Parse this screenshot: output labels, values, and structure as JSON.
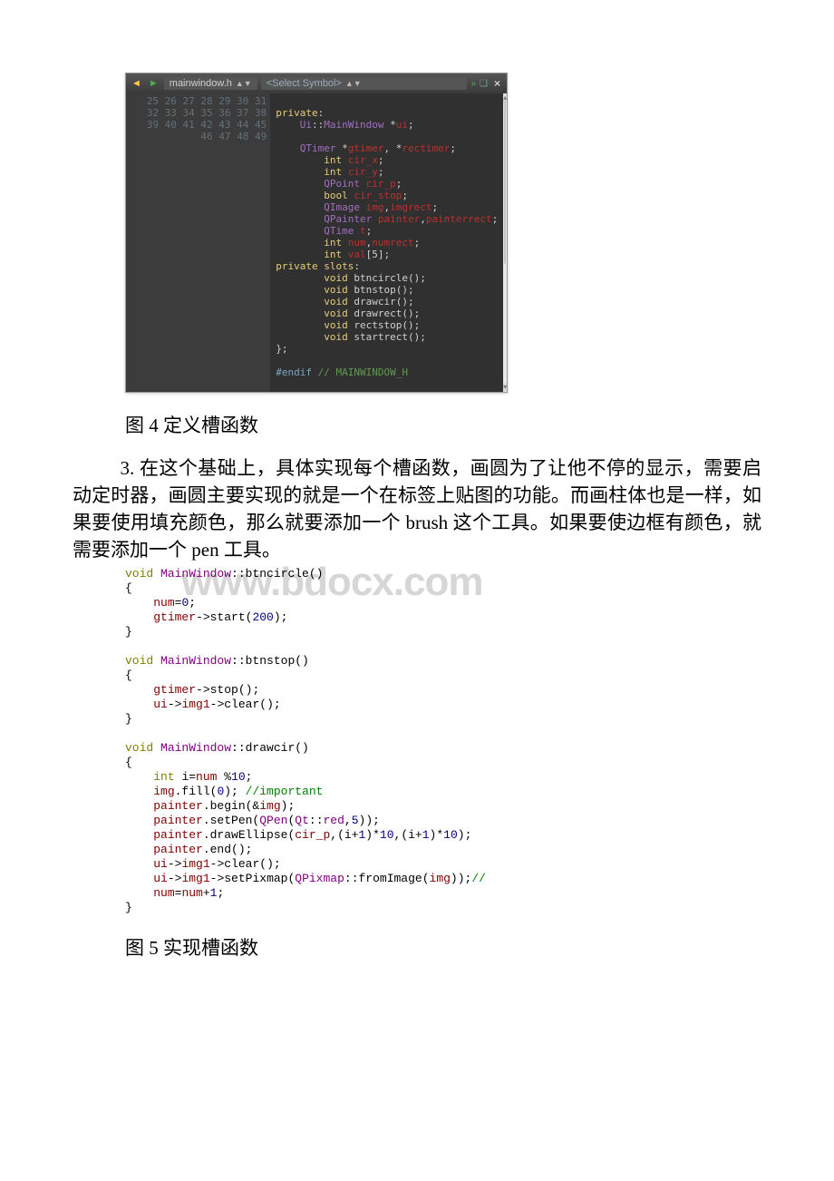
{
  "toolbar": {
    "file_name": "mainwindow.h",
    "symbol_placeholder": "<Select Symbol>"
  },
  "gutter": {
    "start": 25,
    "end": 49
  },
  "header_code": {
    "lines": [
      {
        "n": 25,
        "seg": [
          {
            "t": "",
            "c": ""
          }
        ]
      },
      {
        "n": 26,
        "seg": [
          {
            "t": "private",
            "c": "kw"
          },
          {
            "t": ":",
            "c": "white"
          }
        ]
      },
      {
        "n": 27,
        "seg": [
          {
            "t": "    ",
            "c": ""
          },
          {
            "t": "Ui",
            "c": "type"
          },
          {
            "t": "::",
            "c": "white"
          },
          {
            "t": "MainWindow",
            "c": "type"
          },
          {
            "t": " *",
            "c": "white"
          },
          {
            "t": "ui",
            "c": "ident"
          },
          {
            "t": ";",
            "c": "white"
          }
        ]
      },
      {
        "n": 28,
        "seg": [
          {
            "t": "",
            "c": ""
          }
        ]
      },
      {
        "n": 29,
        "seg": [
          {
            "t": "    ",
            "c": ""
          },
          {
            "t": "QTimer",
            "c": "type"
          },
          {
            "t": " *",
            "c": "white"
          },
          {
            "t": "gtimer",
            "c": "ident"
          },
          {
            "t": ", *",
            "c": "white"
          },
          {
            "t": "rectimer",
            "c": "ident"
          },
          {
            "t": ";",
            "c": "white"
          }
        ]
      },
      {
        "n": 30,
        "seg": [
          {
            "t": "        ",
            "c": ""
          },
          {
            "t": "int",
            "c": "kw2"
          },
          {
            "t": " ",
            "c": ""
          },
          {
            "t": "cir_x",
            "c": "ident"
          },
          {
            "t": ";",
            "c": "white"
          }
        ]
      },
      {
        "n": 31,
        "seg": [
          {
            "t": "        ",
            "c": ""
          },
          {
            "t": "int",
            "c": "kw2"
          },
          {
            "t": " ",
            "c": ""
          },
          {
            "t": "cir_y",
            "c": "ident"
          },
          {
            "t": ";",
            "c": "white"
          }
        ]
      },
      {
        "n": 32,
        "seg": [
          {
            "t": "        ",
            "c": ""
          },
          {
            "t": "QPoint",
            "c": "type"
          },
          {
            "t": " ",
            "c": ""
          },
          {
            "t": "cir_p",
            "c": "ident"
          },
          {
            "t": ";",
            "c": "white"
          }
        ]
      },
      {
        "n": 33,
        "seg": [
          {
            "t": "        ",
            "c": ""
          },
          {
            "t": "bool",
            "c": "kw2"
          },
          {
            "t": " ",
            "c": ""
          },
          {
            "t": "cir_stop",
            "c": "ident"
          },
          {
            "t": ";",
            "c": "white"
          }
        ]
      },
      {
        "n": 34,
        "seg": [
          {
            "t": "        ",
            "c": ""
          },
          {
            "t": "QImage",
            "c": "type"
          },
          {
            "t": " ",
            "c": ""
          },
          {
            "t": "img",
            "c": "ident"
          },
          {
            "t": ",",
            "c": "white"
          },
          {
            "t": "imgrect",
            "c": "ident"
          },
          {
            "t": ";",
            "c": "white"
          }
        ]
      },
      {
        "n": 35,
        "seg": [
          {
            "t": "        ",
            "c": ""
          },
          {
            "t": "QPainter",
            "c": "type"
          },
          {
            "t": " ",
            "c": ""
          },
          {
            "t": "painter",
            "c": "ident"
          },
          {
            "t": ",",
            "c": "white"
          },
          {
            "t": "painterrect",
            "c": "ident"
          },
          {
            "t": ";",
            "c": "white"
          }
        ]
      },
      {
        "n": 36,
        "seg": [
          {
            "t": "        ",
            "c": ""
          },
          {
            "t": "QTime",
            "c": "type"
          },
          {
            "t": " ",
            "c": ""
          },
          {
            "t": "t",
            "c": "ident"
          },
          {
            "t": ";",
            "c": "white"
          }
        ]
      },
      {
        "n": 37,
        "seg": [
          {
            "t": "        ",
            "c": ""
          },
          {
            "t": "int",
            "c": "kw2"
          },
          {
            "t": " ",
            "c": ""
          },
          {
            "t": "num",
            "c": "ident"
          },
          {
            "t": ",",
            "c": "white"
          },
          {
            "t": "numrect",
            "c": "ident"
          },
          {
            "t": ";",
            "c": "white"
          }
        ]
      },
      {
        "n": 38,
        "seg": [
          {
            "t": "        ",
            "c": ""
          },
          {
            "t": "int",
            "c": "kw2"
          },
          {
            "t": " ",
            "c": ""
          },
          {
            "t": "val",
            "c": "ident"
          },
          {
            "t": "[",
            "c": "white"
          },
          {
            "t": "5",
            "c": "white"
          },
          {
            "t": "];",
            "c": "white"
          }
        ]
      },
      {
        "n": 39,
        "seg": [
          {
            "t": "private",
            "c": "kw"
          },
          {
            "t": " ",
            "c": ""
          },
          {
            "t": "slots",
            "c": "kw"
          },
          {
            "t": ":",
            "c": "white"
          }
        ]
      },
      {
        "n": 40,
        "seg": [
          {
            "t": "        ",
            "c": ""
          },
          {
            "t": "void",
            "c": "kw2"
          },
          {
            "t": " ",
            "c": ""
          },
          {
            "t": "btncircle",
            "c": "white"
          },
          {
            "t": "();",
            "c": "white"
          }
        ]
      },
      {
        "n": 41,
        "seg": [
          {
            "t": "        ",
            "c": ""
          },
          {
            "t": "void",
            "c": "kw2"
          },
          {
            "t": " ",
            "c": ""
          },
          {
            "t": "btnstop",
            "c": "white"
          },
          {
            "t": "();",
            "c": "white"
          }
        ]
      },
      {
        "n": 42,
        "seg": [
          {
            "t": "        ",
            "c": ""
          },
          {
            "t": "void",
            "c": "kw2"
          },
          {
            "t": " ",
            "c": ""
          },
          {
            "t": "drawcir",
            "c": "white"
          },
          {
            "t": "();",
            "c": "white"
          }
        ]
      },
      {
        "n": 43,
        "seg": [
          {
            "t": "        ",
            "c": ""
          },
          {
            "t": "void",
            "c": "kw2"
          },
          {
            "t": " ",
            "c": ""
          },
          {
            "t": "drawrect",
            "c": "white"
          },
          {
            "t": "();",
            "c": "white"
          }
        ]
      },
      {
        "n": 44,
        "seg": [
          {
            "t": "        ",
            "c": ""
          },
          {
            "t": "void",
            "c": "kw2"
          },
          {
            "t": " ",
            "c": ""
          },
          {
            "t": "rectstop",
            "c": "white"
          },
          {
            "t": "();",
            "c": "white"
          }
        ]
      },
      {
        "n": 45,
        "seg": [
          {
            "t": "        ",
            "c": ""
          },
          {
            "t": "void",
            "c": "kw2"
          },
          {
            "t": " ",
            "c": ""
          },
          {
            "t": "startrect",
            "c": "white"
          },
          {
            "t": "();",
            "c": "white"
          }
        ]
      },
      {
        "n": 46,
        "seg": [
          {
            "t": "};",
            "c": "white"
          }
        ]
      },
      {
        "n": 47,
        "seg": [
          {
            "t": "",
            "c": ""
          }
        ]
      },
      {
        "n": 48,
        "seg": [
          {
            "t": "#endif",
            "c": "prep"
          },
          {
            "t": " ",
            "c": ""
          },
          {
            "t": "// MAINWINDOW_H",
            "c": "cmt"
          }
        ]
      },
      {
        "n": 49,
        "seg": [
          {
            "t": "",
            "c": ""
          }
        ]
      }
    ]
  },
  "caption4": "图 4 定义槽函数",
  "paragraph3": "3. 在这个基础上，具体实现每个槽函数，画圆为了让他不停的显示，需要启动定时器，画圆主要实现的就是一个在标签上贴图的功能。而画柱体也是一样，如果要使用填充颜色，那么就要添加一个 brush 这个工具。如果要使边框有颜色，就需要添加一个 pen 工具。",
  "watermark": "www.bdocx.com",
  "cpp_code": {
    "lines": [
      [
        {
          "t": "void ",
          "c": "kw"
        },
        {
          "t": "MainWindow",
          "c": "cls"
        },
        {
          "t": "::btncircle()",
          "c": "punct"
        }
      ],
      [
        {
          "t": "{",
          "c": "punct"
        }
      ],
      [
        {
          "t": "    ",
          "c": ""
        },
        {
          "t": "num",
          "c": "mem"
        },
        {
          "t": "=",
          "c": "punct"
        },
        {
          "t": "0",
          "c": "num"
        },
        {
          "t": ";",
          "c": "punct"
        }
      ],
      [
        {
          "t": "    ",
          "c": ""
        },
        {
          "t": "gtimer",
          "c": "mem"
        },
        {
          "t": "->start(",
          "c": "punct"
        },
        {
          "t": "200",
          "c": "num"
        },
        {
          "t": ");",
          "c": "punct"
        }
      ],
      [
        {
          "t": "}",
          "c": "punct"
        }
      ],
      [
        {
          "t": "",
          "c": ""
        }
      ],
      [
        {
          "t": "void ",
          "c": "kw"
        },
        {
          "t": "MainWindow",
          "c": "cls"
        },
        {
          "t": "::btnstop()",
          "c": "punct"
        }
      ],
      [
        {
          "t": "{",
          "c": "punct"
        }
      ],
      [
        {
          "t": "    ",
          "c": ""
        },
        {
          "t": "gtimer",
          "c": "mem"
        },
        {
          "t": "->stop();",
          "c": "punct"
        }
      ],
      [
        {
          "t": "    ",
          "c": ""
        },
        {
          "t": "ui",
          "c": "mem"
        },
        {
          "t": "->",
          "c": "punct"
        },
        {
          "t": "img1",
          "c": "mem"
        },
        {
          "t": "->clear();",
          "c": "punct"
        }
      ],
      [
        {
          "t": "}",
          "c": "punct"
        }
      ],
      [
        {
          "t": "",
          "c": ""
        }
      ],
      [
        {
          "t": "void ",
          "c": "kw"
        },
        {
          "t": "MainWindow",
          "c": "cls"
        },
        {
          "t": "::drawcir()",
          "c": "punct"
        }
      ],
      [
        {
          "t": "{",
          "c": "punct"
        }
      ],
      [
        {
          "t": "    ",
          "c": ""
        },
        {
          "t": "int ",
          "c": "kw"
        },
        {
          "t": "i=",
          "c": "punct"
        },
        {
          "t": "num",
          "c": "mem"
        },
        {
          "t": " %",
          "c": "punct"
        },
        {
          "t": "10",
          "c": "num"
        },
        {
          "t": ";",
          "c": "punct"
        }
      ],
      [
        {
          "t": "    ",
          "c": ""
        },
        {
          "t": "img",
          "c": "mem"
        },
        {
          "t": ".fill(",
          "c": "punct"
        },
        {
          "t": "0",
          "c": "num"
        },
        {
          "t": "); ",
          "c": "punct"
        },
        {
          "t": "//important",
          "c": "cmt"
        }
      ],
      [
        {
          "t": "    ",
          "c": ""
        },
        {
          "t": "painter",
          "c": "mem"
        },
        {
          "t": ".begin(&",
          "c": "punct"
        },
        {
          "t": "img",
          "c": "mem"
        },
        {
          "t": ");",
          "c": "punct"
        }
      ],
      [
        {
          "t": "    ",
          "c": ""
        },
        {
          "t": "painter",
          "c": "mem"
        },
        {
          "t": ".setPen(",
          "c": "punct"
        },
        {
          "t": "QPen",
          "c": "cls"
        },
        {
          "t": "(",
          "c": "punct"
        },
        {
          "t": "Qt",
          "c": "cls"
        },
        {
          "t": "::",
          "c": "punct"
        },
        {
          "t": "red",
          "c": "enum"
        },
        {
          "t": ",",
          "c": "punct"
        },
        {
          "t": "5",
          "c": "num"
        },
        {
          "t": "));",
          "c": "punct"
        }
      ],
      [
        {
          "t": "    ",
          "c": ""
        },
        {
          "t": "painter",
          "c": "mem"
        },
        {
          "t": ".drawEllipse(",
          "c": "punct"
        },
        {
          "t": "cir_p",
          "c": "mem"
        },
        {
          "t": ",(i+",
          "c": "punct"
        },
        {
          "t": "1",
          "c": "num"
        },
        {
          "t": ")*",
          "c": "punct"
        },
        {
          "t": "10",
          "c": "num"
        },
        {
          "t": ",(i+",
          "c": "punct"
        },
        {
          "t": "1",
          "c": "num"
        },
        {
          "t": ")*",
          "c": "punct"
        },
        {
          "t": "10",
          "c": "num"
        },
        {
          "t": ");",
          "c": "punct"
        }
      ],
      [
        {
          "t": "    ",
          "c": ""
        },
        {
          "t": "painter",
          "c": "mem"
        },
        {
          "t": ".end();",
          "c": "punct"
        }
      ],
      [
        {
          "t": "    ",
          "c": ""
        },
        {
          "t": "ui",
          "c": "mem"
        },
        {
          "t": "->",
          "c": "punct"
        },
        {
          "t": "img1",
          "c": "mem"
        },
        {
          "t": "->clear();",
          "c": "punct"
        }
      ],
      [
        {
          "t": "    ",
          "c": ""
        },
        {
          "t": "ui",
          "c": "mem"
        },
        {
          "t": "->",
          "c": "punct"
        },
        {
          "t": "img1",
          "c": "mem"
        },
        {
          "t": "->setPixmap(",
          "c": "punct"
        },
        {
          "t": "QPixmap",
          "c": "cls"
        },
        {
          "t": "::fromImage(",
          "c": "punct"
        },
        {
          "t": "img",
          "c": "mem"
        },
        {
          "t": "));",
          "c": "punct"
        },
        {
          "t": "//",
          "c": "cmt"
        }
      ],
      [
        {
          "t": "    ",
          "c": ""
        },
        {
          "t": "num",
          "c": "mem"
        },
        {
          "t": "=",
          "c": "punct"
        },
        {
          "t": "num",
          "c": "mem"
        },
        {
          "t": "+",
          "c": "punct"
        },
        {
          "t": "1",
          "c": "num"
        },
        {
          "t": ";",
          "c": "punct"
        }
      ],
      [
        {
          "t": "}",
          "c": "punct"
        }
      ]
    ]
  },
  "caption5": "图 5 实现槽函数"
}
